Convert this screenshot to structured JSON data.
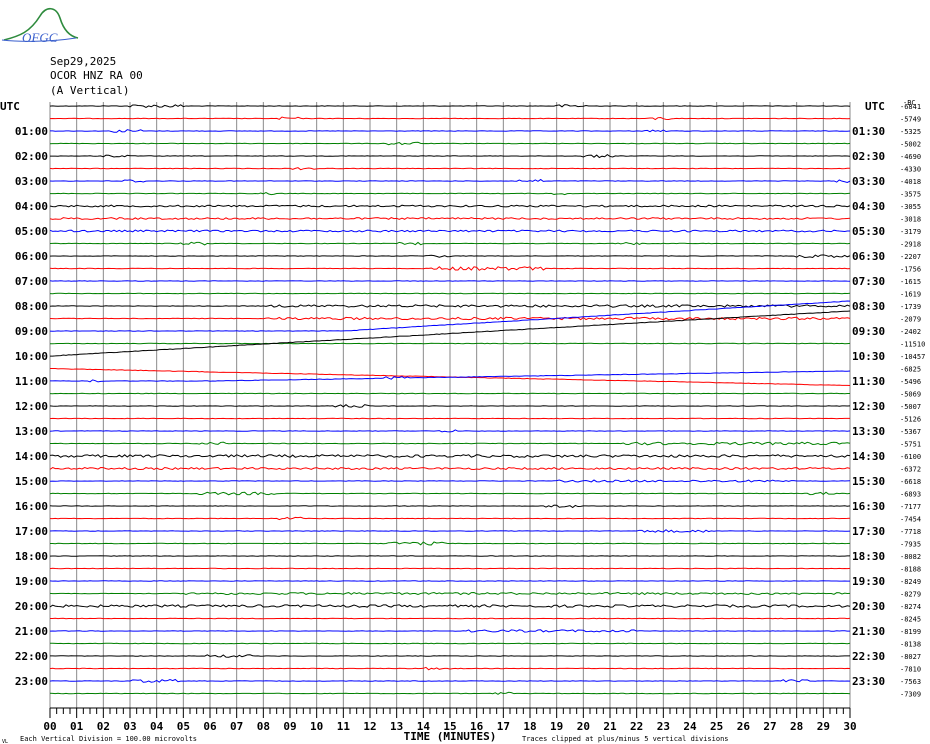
{
  "logo": {
    "text": "OFGC",
    "name": "ofgc-logo"
  },
  "header": {
    "date": "Sep29,2025",
    "station": "OCOR HNZ RA 00",
    "component": "(A Vertical)"
  },
  "chart_data": {
    "type": "line",
    "title": "Sep29,2025 OCOR HNZ RA 00 (A Vertical)",
    "xlabel": "TIME (MINUTES)",
    "xlim": [
      0,
      30
    ],
    "x_ticks": [
      "00",
      "01",
      "02",
      "03",
      "04",
      "05",
      "06",
      "07",
      "08",
      "09",
      "10",
      "11",
      "12",
      "13",
      "14",
      "15",
      "16",
      "17",
      "18",
      "19",
      "20",
      "21",
      "22",
      "23",
      "24",
      "25",
      "26",
      "27",
      "28",
      "29",
      "30"
    ],
    "left_axis_title": "UTC",
    "right_axis_title": "UTC",
    "left_labels": [
      "01:00",
      "02:00",
      "03:00",
      "04:00",
      "05:00",
      "06:00",
      "07:00",
      "08:00",
      "09:00",
      "10:00",
      "11:00",
      "12:00",
      "13:00",
      "14:00",
      "15:00",
      "16:00",
      "17:00",
      "18:00",
      "19:00",
      "20:00",
      "21:00",
      "22:00",
      "23:00"
    ],
    "right_labels": [
      "01:30",
      "02:30",
      "03:30",
      "04:30",
      "05:30",
      "06:30",
      "07:30",
      "08:30",
      "09:30",
      "10:30",
      "11:30",
      "12:30",
      "13:30",
      "14:30",
      "15:30",
      "16:30",
      "17:30",
      "18:30",
      "19:30",
      "20:30",
      "21:30",
      "22:30",
      "23:30"
    ],
    "offset_corner_label": "-BC",
    "trace_offsets": [
      -6841,
      -5749,
      -5325,
      -5002,
      -4690,
      -4330,
      -4018,
      -3575,
      -3055,
      -3018,
      -3179,
      -2918,
      -2207,
      -1756,
      -1615,
      -1619,
      -1739,
      -2079,
      -2402,
      -11510,
      -10457,
      -6825,
      -5496,
      -5069,
      -5007,
      -5126,
      -5367,
      -5751,
      -6100,
      -6372,
      -6618,
      -6893,
      -7177,
      -7454,
      -7718,
      -7935,
      -8082,
      -8188,
      -8249,
      -8279,
      -8274,
      -8245,
      -8199,
      -8138,
      -8027,
      -7810,
      -7563,
      -7309
    ],
    "trace_colors": [
      "#000000",
      "#ff0000",
      "#0000ff",
      "#008000"
    ],
    "grid": true,
    "footer_left": "Each Vertical Division =  100.00 microvolts",
    "footer_right": "Traces clipped at plus/minus 5 vertical divisions",
    "corner_mark": "VL",
    "drifts": [
      {
        "trace": 20,
        "x0": 0,
        "x1": 30,
        "dy0": 0,
        "dy1": -45
      },
      {
        "trace": 18,
        "x0": 11,
        "x1": 30,
        "dy0": 0,
        "dy1": -30
      },
      {
        "trace": 21,
        "x0": 0,
        "x1": 30,
        "dy0": 0,
        "dy1": 17
      },
      {
        "trace": 22,
        "x0": 6,
        "x1": 30,
        "dy0": 0,
        "dy1": -10
      }
    ],
    "bursts": [
      {
        "trace": 0,
        "x0": 3,
        "x1": 5,
        "amp": 1.5
      },
      {
        "trace": 0,
        "x0": 19,
        "x1": 20.2,
        "amp": 1.5
      },
      {
        "trace": 1,
        "x0": 8.5,
        "x1": 9.3,
        "amp": 1.5
      },
      {
        "trace": 1,
        "x0": 22.5,
        "x1": 23.4,
        "amp": 1.5
      },
      {
        "trace": 2,
        "x0": 2.3,
        "x1": 3.5,
        "amp": 1.5
      },
      {
        "trace": 2,
        "x0": 22.3,
        "x1": 23.2,
        "amp": 1.5
      },
      {
        "trace": 3,
        "x0": 12.5,
        "x1": 13.8,
        "amp": 1.5
      },
      {
        "trace": 4,
        "x0": 2,
        "x1": 3,
        "amp": 1.2
      },
      {
        "trace": 4,
        "x0": 20,
        "x1": 21.2,
        "amp": 1.5
      },
      {
        "trace": 5,
        "x0": 9,
        "x1": 10,
        "amp": 1.2
      },
      {
        "trace": 6,
        "x0": 2.6,
        "x1": 3.6,
        "amp": 1.5
      },
      {
        "trace": 6,
        "x0": 17.5,
        "x1": 18.5,
        "amp": 1.5
      },
      {
        "trace": 6,
        "x0": 29.5,
        "x1": 30,
        "amp": 1.5
      },
      {
        "trace": 7,
        "x0": 7.7,
        "x1": 8.4,
        "amp": 1.2
      },
      {
        "trace": 7,
        "x0": 18.8,
        "x1": 19.4,
        "amp": 1.2
      },
      {
        "trace": 8,
        "x0": 0,
        "x1": 30,
        "amp": 0.9
      },
      {
        "trace": 9,
        "x0": 0,
        "x1": 30,
        "amp": 0.9
      },
      {
        "trace": 10,
        "x0": 0,
        "x1": 30,
        "amp": 0.9
      },
      {
        "trace": 11,
        "x0": 4.8,
        "x1": 6,
        "amp": 1.5
      },
      {
        "trace": 11,
        "x0": 13,
        "x1": 14,
        "amp": 1.2
      },
      {
        "trace": 11,
        "x0": 21.3,
        "x1": 22.2,
        "amp": 1.2
      },
      {
        "trace": 12,
        "x0": 14,
        "x1": 15,
        "amp": 1.5
      },
      {
        "trace": 12,
        "x0": 28,
        "x1": 30,
        "amp": 1.5
      },
      {
        "trace": 13,
        "x0": 14.2,
        "x1": 18.5,
        "amp": 1.8
      },
      {
        "trace": 16,
        "x0": 8,
        "x1": 30,
        "amp": 1.2
      },
      {
        "trace": 17,
        "x0": 8,
        "x1": 30,
        "amp": 1.2
      },
      {
        "trace": 22,
        "x0": 1.5,
        "x1": 2,
        "amp": 1.2
      },
      {
        "trace": 22,
        "x0": 12.5,
        "x1": 13.5,
        "amp": 1.5
      },
      {
        "trace": 24,
        "x0": 10.5,
        "x1": 12,
        "amp": 1.5
      },
      {
        "trace": 26,
        "x0": 14.5,
        "x1": 15.2,
        "amp": 1.2
      },
      {
        "trace": 27,
        "x0": 5.5,
        "x1": 6.5,
        "amp": 1.5
      },
      {
        "trace": 27,
        "x0": 21.5,
        "x1": 30,
        "amp": 1.3
      },
      {
        "trace": 28,
        "x0": 0,
        "x1": 30,
        "amp": 1.3
      },
      {
        "trace": 29,
        "x0": 0,
        "x1": 30,
        "amp": 1.0
      },
      {
        "trace": 30,
        "x0": 19,
        "x1": 28,
        "amp": 1.0
      },
      {
        "trace": 31,
        "x0": 5.5,
        "x1": 8.5,
        "amp": 1.3
      },
      {
        "trace": 31,
        "x0": 28.5,
        "x1": 29.5,
        "amp": 1.3
      },
      {
        "trace": 32,
        "x0": 18.5,
        "x1": 20,
        "amp": 1.5
      },
      {
        "trace": 33,
        "x0": 8.5,
        "x1": 9.5,
        "amp": 1.3
      },
      {
        "trace": 34,
        "x0": 22,
        "x1": 24.8,
        "amp": 1.3
      },
      {
        "trace": 35,
        "x0": 12.5,
        "x1": 14.8,
        "amp": 1.5
      },
      {
        "trace": 39,
        "x0": 5,
        "x1": 30,
        "amp": 1.0
      },
      {
        "trace": 40,
        "x0": 0,
        "x1": 30,
        "amp": 1.2
      },
      {
        "trace": 42,
        "x0": 15.5,
        "x1": 22,
        "amp": 1.2
      },
      {
        "trace": 44,
        "x0": 5.8,
        "x1": 7.5,
        "amp": 1.3
      },
      {
        "trace": 45,
        "x0": 14,
        "x1": 15,
        "amp": 1.3
      },
      {
        "trace": 46,
        "x0": 3,
        "x1": 4.8,
        "amp": 1.5
      },
      {
        "trace": 46,
        "x0": 27.5,
        "x1": 28.5,
        "amp": 1.3
      },
      {
        "trace": 47,
        "x0": 16.5,
        "x1": 17.3,
        "amp": 1.2
      }
    ]
  }
}
